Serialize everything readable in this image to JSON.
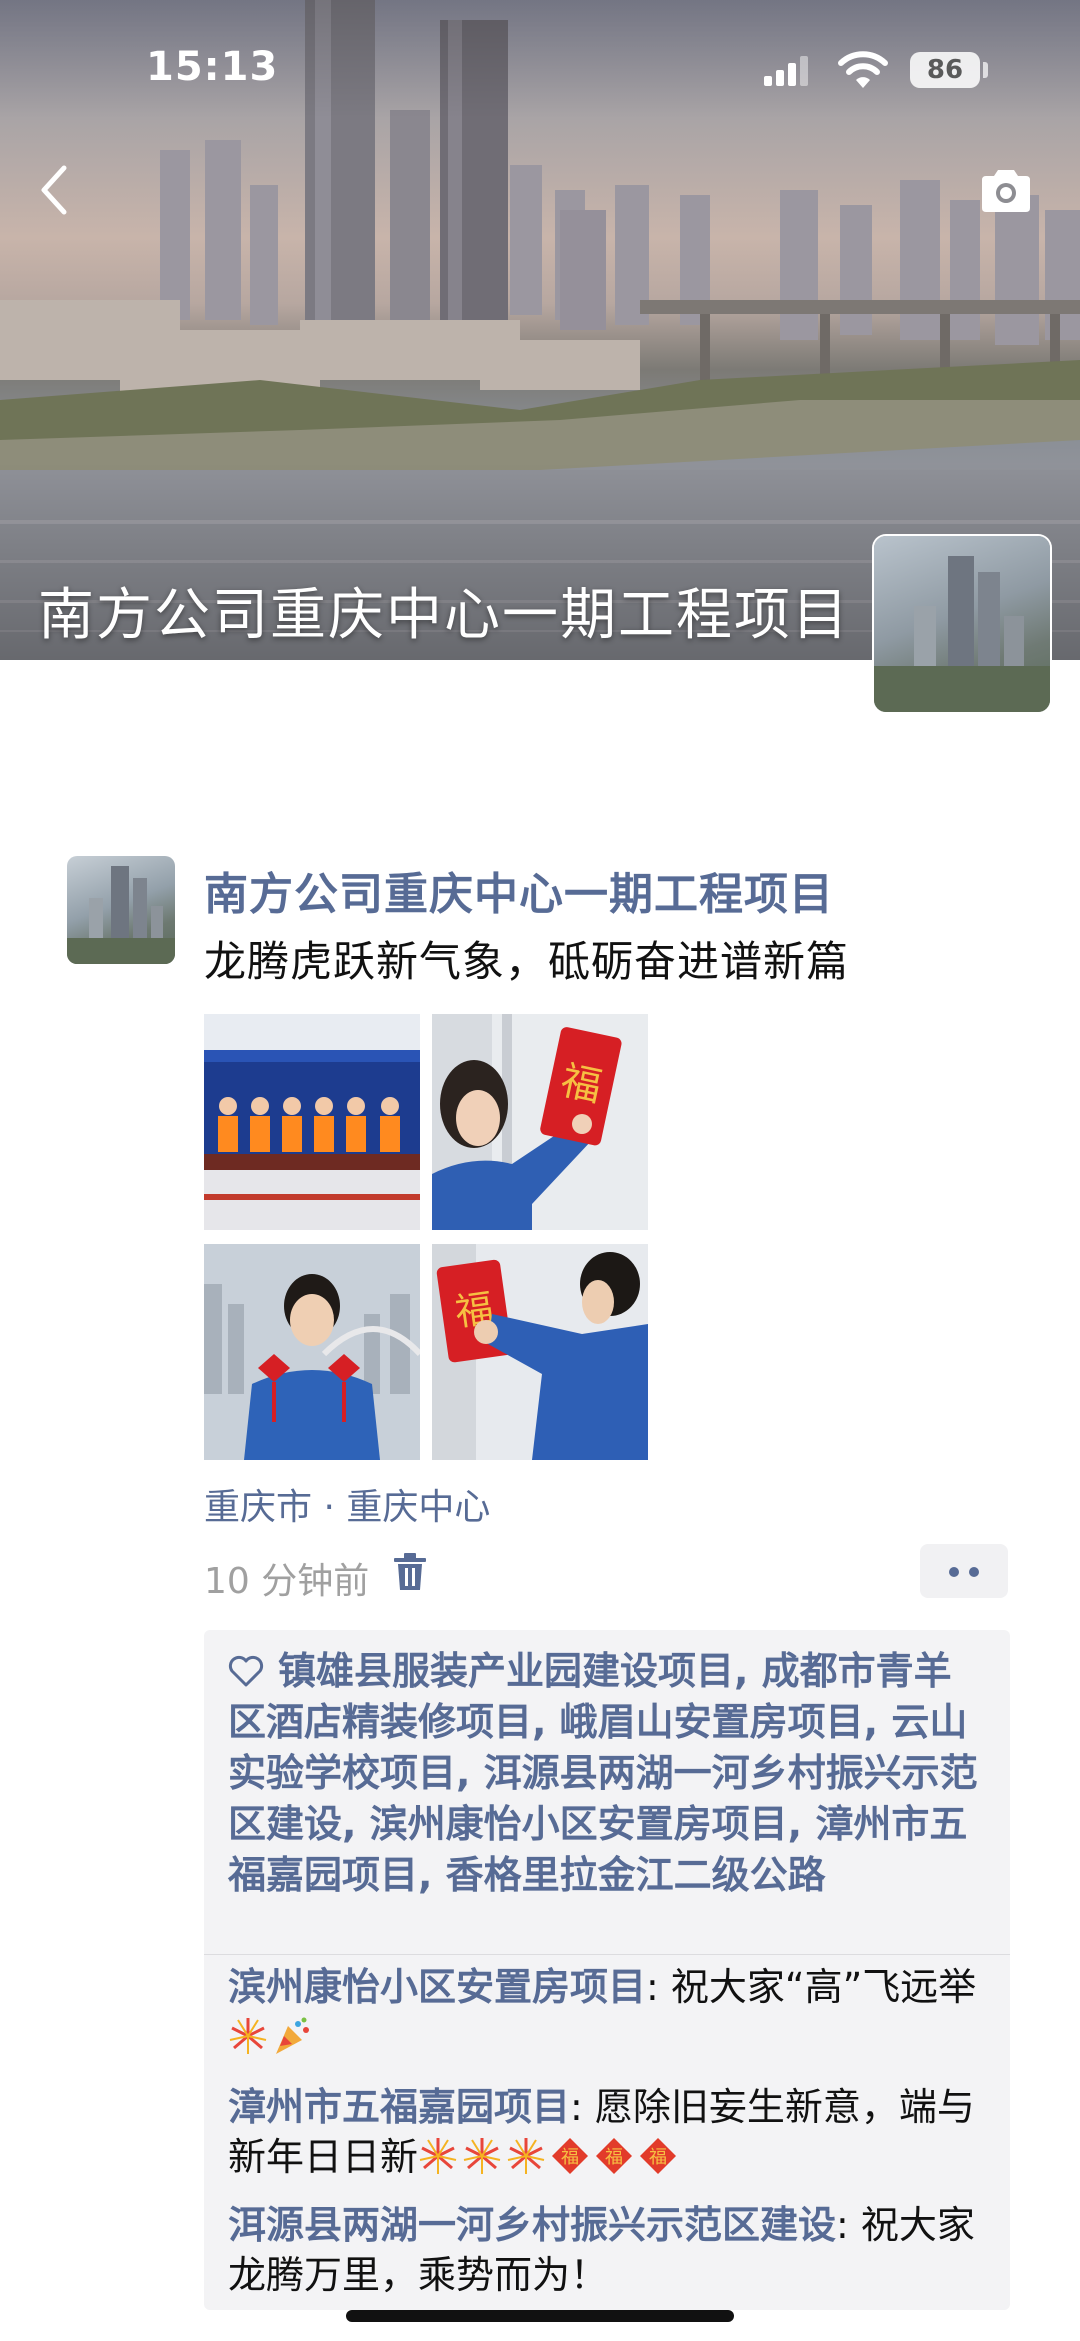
{
  "status_bar": {
    "time": "15:13",
    "battery": "86"
  },
  "cover": {
    "title": "南方公司重庆中心一期工程项目"
  },
  "post": {
    "author": "南方公司重庆中心一期工程项目",
    "text": "龙腾虎跃新气象，砥砺奋进谱新篇",
    "location": "重庆市 · 重庆中心",
    "time": "10 分钟前"
  },
  "likes": {
    "text": "镇雄县服装产业园建设项目, 成都市青羊区酒店精装修项目, 峨眉山安置房项目, 云山实验学校项目, 洱源县两湖一河乡村振兴示范区建设, 滨州康怡小区安置房项目, 漳州市五福嘉园项目, 香格里拉金江二级公路"
  },
  "comments": [
    {
      "name": "滨州康怡小区安置房项目",
      "text": "祝大家“高”飞远举",
      "emojis": [
        "firework-icon",
        "party-popper-icon"
      ]
    },
    {
      "name": "漳州市五福嘉园项目",
      "text": "愿除旧妄生新意，端与新年日日新",
      "emojis": [
        "firework-icon",
        "firework-icon",
        "firework-icon",
        "fu-charm-icon",
        "fu-charm-icon",
        "fu-charm-icon"
      ]
    },
    {
      "name": "洱源县两湖一河乡村振兴示范区建设",
      "text": "祝大家龙腾万里，乘势而为！",
      "emojis": []
    }
  ],
  "colors": {
    "link": "#576b95",
    "panel_bg": "#f3f3f5",
    "time_gray": "#a0a0a0"
  }
}
